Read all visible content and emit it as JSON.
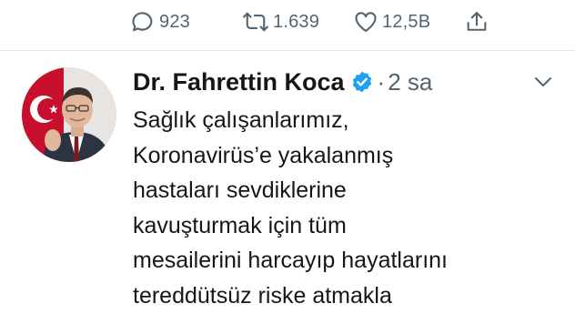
{
  "actions": {
    "reply": {
      "icon": "reply-icon",
      "count": "923"
    },
    "retweet": {
      "icon": "retweet-icon",
      "count": "1.639"
    },
    "like": {
      "icon": "heart-icon",
      "count": "12,5B"
    },
    "share": {
      "icon": "share-icon"
    }
  },
  "tweet": {
    "author": {
      "display_name": "Dr. Fahrettin Koca",
      "verified": true
    },
    "separator": "·",
    "time": "2 sa",
    "text_lines": [
      "Sağlık çalışanlarımız,",
      "Koronavirüs’e yakalanmış",
      "hastaları sevdiklerine",
      "kavuşturmak için tüm",
      "mesailerini harcayıp hayatlarını",
      "tereddütsüz riske atmakla"
    ]
  },
  "colors": {
    "text": "#14171a",
    "muted": "#536471",
    "verified_badge": "#1da1f2",
    "divider": "#e1e8ed"
  }
}
